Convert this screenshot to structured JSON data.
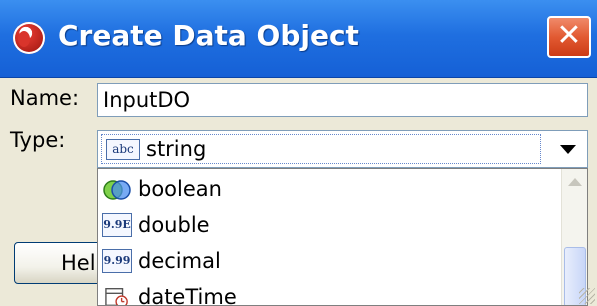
{
  "window": {
    "title": "Create Data Object",
    "close_glyph": "✕"
  },
  "form": {
    "name_label": "Name:",
    "name_value": "InputDO",
    "type_label": "Type:",
    "type_icon_text": "abc",
    "type_value": "string"
  },
  "buttons": {
    "help_label": "Help"
  },
  "type_options": [
    {
      "label": "boolean",
      "icon": "boolean-icon"
    },
    {
      "label": "double",
      "icon_text": "9.9E"
    },
    {
      "label": "decimal",
      "icon_text": "9.99"
    },
    {
      "label": "dateTime",
      "icon": "datetime-icon"
    }
  ],
  "colors": {
    "titlebar": "#1f6fe0",
    "dialog_bg": "#ece9d8",
    "close_button": "#e25a32"
  }
}
